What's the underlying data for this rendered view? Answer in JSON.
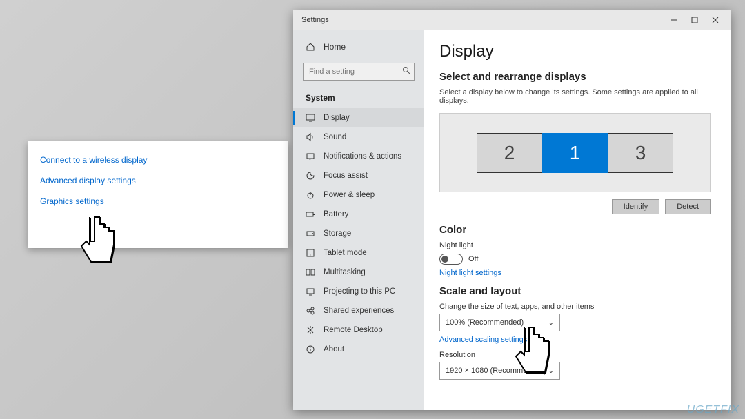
{
  "popup": {
    "links": [
      "Connect to a wireless display",
      "Advanced display settings",
      "Graphics settings"
    ]
  },
  "window": {
    "title": "Settings",
    "sidebar": {
      "home": "Home",
      "search_placeholder": "Find a setting",
      "section": "System",
      "items": [
        {
          "label": "Display"
        },
        {
          "label": "Sound"
        },
        {
          "label": "Notifications & actions"
        },
        {
          "label": "Focus assist"
        },
        {
          "label": "Power & sleep"
        },
        {
          "label": "Battery"
        },
        {
          "label": "Storage"
        },
        {
          "label": "Tablet mode"
        },
        {
          "label": "Multitasking"
        },
        {
          "label": "Projecting to this PC"
        },
        {
          "label": "Shared experiences"
        },
        {
          "label": "Remote Desktop"
        },
        {
          "label": "About"
        }
      ]
    },
    "content": {
      "page_title": "Display",
      "arrange_title": "Select and rearrange displays",
      "arrange_desc": "Select a display below to change its settings. Some settings are applied to all displays.",
      "displays": [
        "2",
        "1",
        "3"
      ],
      "active_display_index": 1,
      "identify_btn": "Identify",
      "detect_btn": "Detect",
      "color_title": "Color",
      "night_light_label": "Night light",
      "night_light_state": "Off",
      "night_light_link": "Night light settings",
      "scale_title": "Scale and layout",
      "scale_label": "Change the size of text, apps, and other items",
      "scale_value": "100% (Recommended)",
      "advanced_scaling": "Advanced scaling settings",
      "resolution_label": "Resolution",
      "resolution_value": "1920 × 1080 (Recommended)"
    }
  },
  "watermark": "UGETFIX"
}
